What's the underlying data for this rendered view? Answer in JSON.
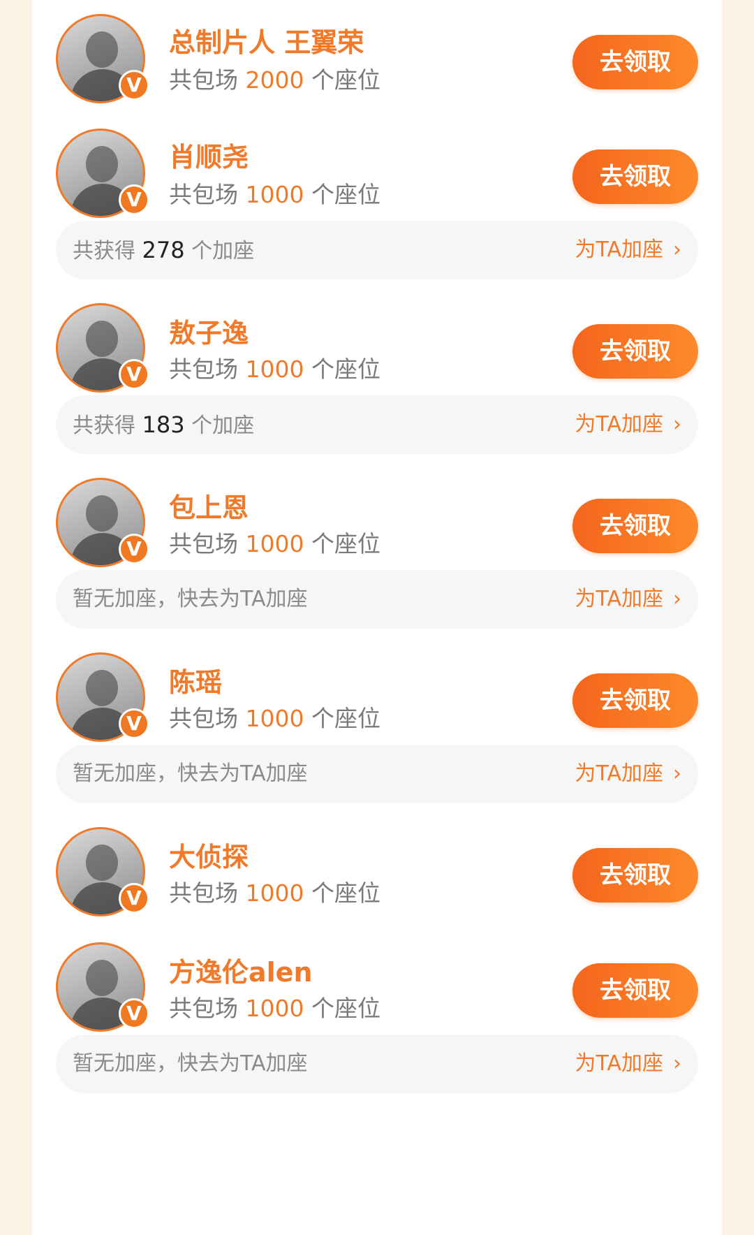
{
  "claim_label": "去领取",
  "seat_prefix": "共包场",
  "seat_suffix": "个座位",
  "extra_prefix": "共获得",
  "extra_suffix": "个加座",
  "no_extra_text": "暂无加座，快去为TA加座",
  "add_seat_link": "为TA加座",
  "chevron": "›",
  "verified_badge": "V",
  "colors": {
    "accent": "#f07a2a",
    "button": "#f4651c",
    "page_bg": "#fdf3e6"
  },
  "items": [
    {
      "name": "总制片人 王翼荣",
      "seats": "2000"
    },
    {
      "name": "肖顺尧",
      "seats": "1000",
      "extra_count": "278"
    },
    {
      "name": "敖子逸",
      "seats": "1000",
      "extra_count": "183"
    },
    {
      "name": "包上恩",
      "seats": "1000"
    },
    {
      "name": "陈瑶",
      "seats": "1000"
    },
    {
      "name": "大侦探",
      "seats": "1000"
    },
    {
      "name": "方逸伦alen",
      "seats": "1000"
    }
  ]
}
